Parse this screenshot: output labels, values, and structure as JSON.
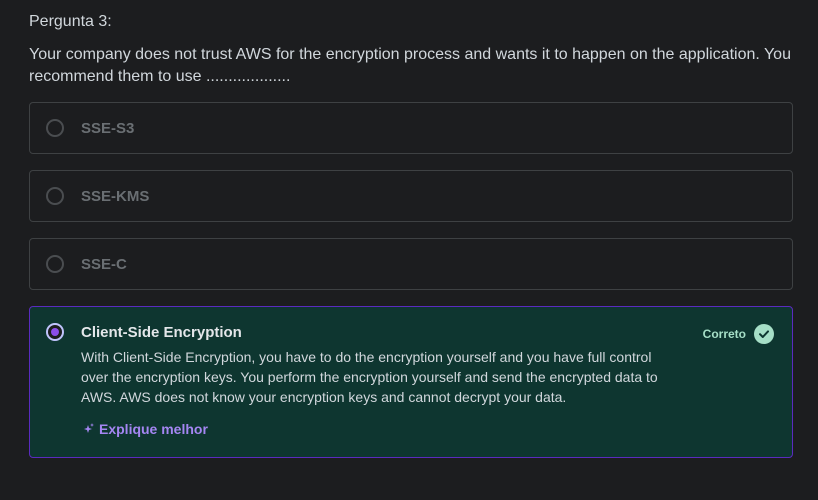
{
  "question": {
    "number_label": "Pergunta 3:",
    "text": "Your company does not trust AWS for the encryption process and wants it to happen on the application. You recommend them to use ..................."
  },
  "options": [
    {
      "label": "SSE-S3",
      "selected": false
    },
    {
      "label": "SSE-KMS",
      "selected": false
    },
    {
      "label": "SSE-C",
      "selected": false
    },
    {
      "label": "Client-Side Encryption",
      "selected": true,
      "status": "Correto",
      "status_icon": "check-circle-icon",
      "explanation": "With Client-Side Encryption, you have to do the encryption yourself and you have full control over the encryption keys. You perform the encryption yourself and send the encrypted data to AWS. AWS does not know your encryption keys and cannot decrypt your data.",
      "explain_more_label": "Explique melhor",
      "explain_more_icon": "sparkle-icon"
    }
  ],
  "colors": {
    "background": "#1c1d1f",
    "correct_bg": "#0e3630",
    "correct_accent": "#a6dfc7",
    "selected_border": "#5a2bbf",
    "link_purple": "#a486f2"
  }
}
